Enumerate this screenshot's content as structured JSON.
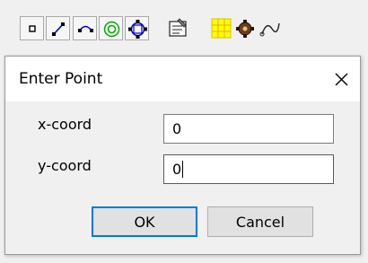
{
  "toolbar": {
    "buttons": [
      {
        "icon": "point-icon"
      },
      {
        "icon": "line-icon"
      },
      {
        "icon": "arc-icon"
      },
      {
        "icon": "circle-icon"
      },
      {
        "icon": "polygon-icon"
      },
      {
        "icon": "properties-icon"
      },
      {
        "icon": "grid-icon"
      },
      {
        "icon": "gear-icon"
      },
      {
        "icon": "curve-icon"
      }
    ]
  },
  "dialog": {
    "title": "Enter Point",
    "close_symbol": "✕",
    "x_label": "x-coord",
    "x_value": "0",
    "y_label": "y-coord",
    "y_value": "0",
    "ok_label": "OK",
    "cancel_label": "Cancel"
  }
}
